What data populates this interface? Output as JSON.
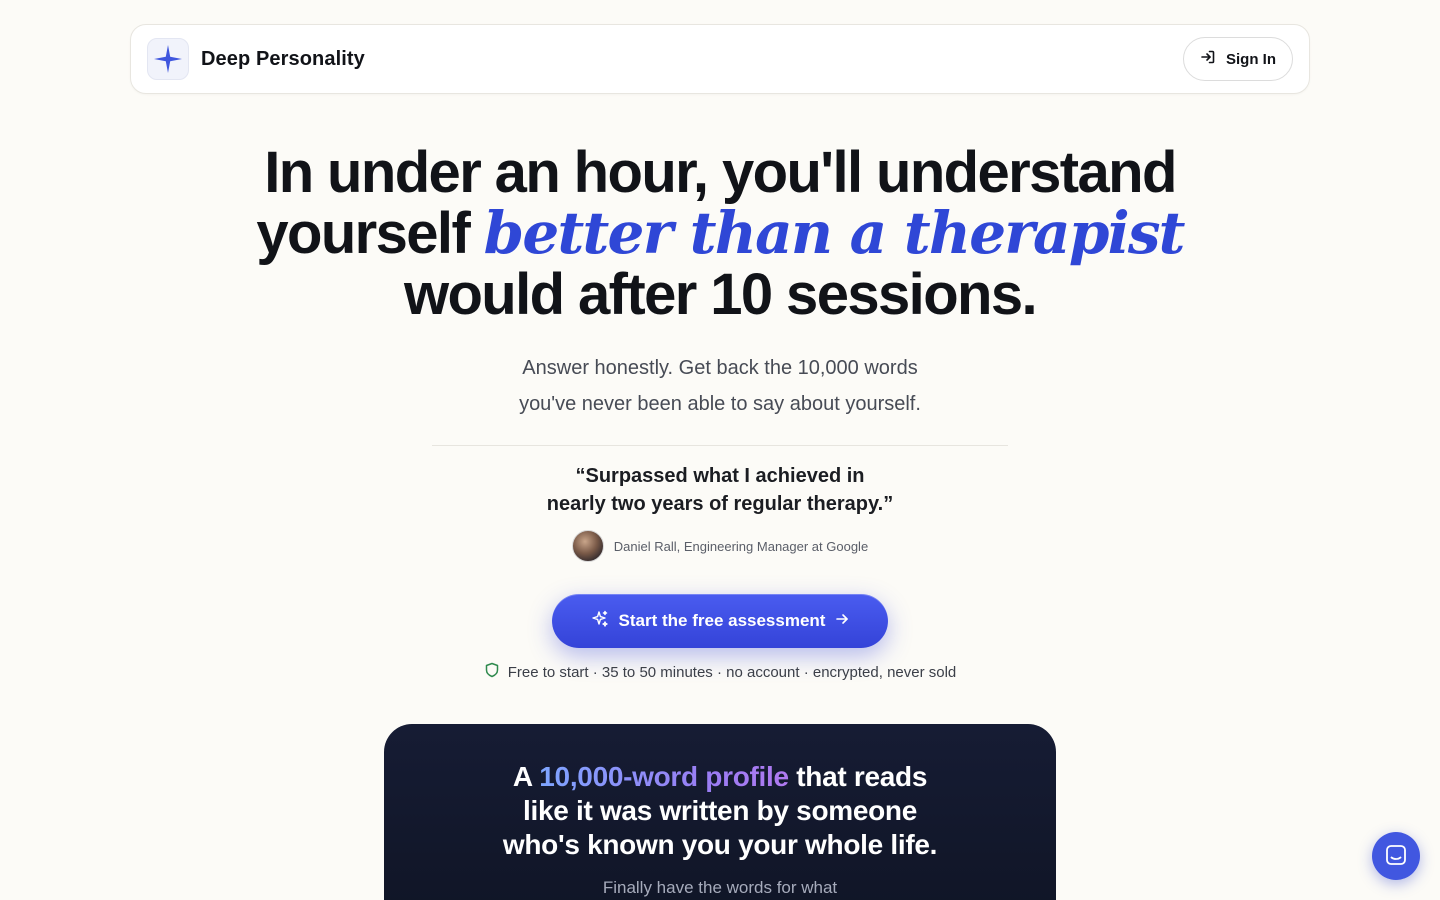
{
  "header": {
    "brand_name": "Deep Personality",
    "signin_label": "Sign In"
  },
  "hero": {
    "headline_line1": "In under an hour, you'll understand",
    "headline_line2_plain": "yourself",
    "headline_line2_accent": "better than a therapist",
    "headline_line3": "would after 10 sessions.",
    "sub_line1": "Answer honestly. Get back the 10,000 words",
    "sub_line2": "you've never been able to say about yourself."
  },
  "testimonial": {
    "quote_line1": "“Surpassed what I achieved in",
    "quote_line2": "nearly two years of regular therapy.”",
    "author": "Daniel Rall, Engineering Manager at Google"
  },
  "cta": {
    "label": "Start the free assessment",
    "trust_text": "Free to start · 35 to 50 minutes · no account · encrypted, never sold"
  },
  "profile_card": {
    "title_prefix": "A",
    "title_highlight": "10,000-word profile",
    "title_rest_line1": "that reads",
    "title_line2": "like it was written by someone",
    "title_line3": "who's known you your whole life.",
    "subtitle": "Finally have the words for what"
  },
  "colors": {
    "accent": "#2f47d6",
    "button": "#3d4fe6",
    "background": "#fcfbf7",
    "dark_card": "#131a2e"
  },
  "icons": [
    "sparkle-logo-icon",
    "sign-in-icon",
    "sparkles-icon",
    "arrow-right-icon",
    "shield-icon",
    "chat-icon"
  ]
}
